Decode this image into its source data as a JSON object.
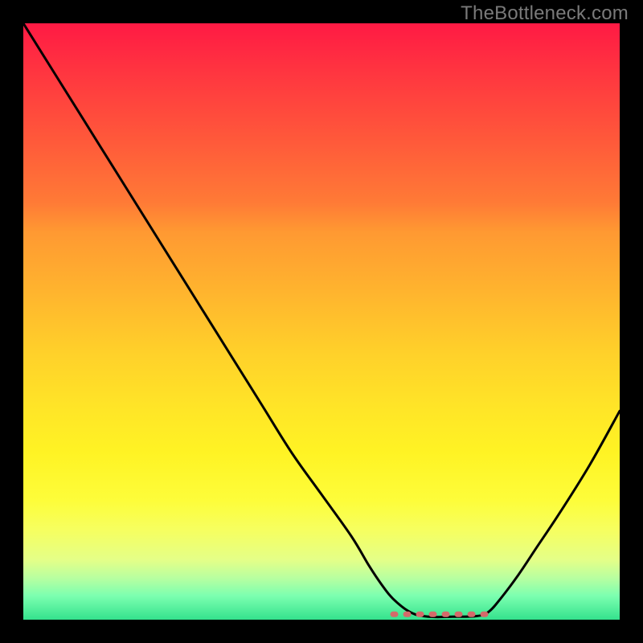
{
  "watermark": "TheBottleneck.com",
  "colors": {
    "background": "#000000",
    "gradient_top": "#ff1a44",
    "gradient_mid": "#fff324",
    "gradient_bottom": "#34e28d",
    "curve": "#000000",
    "marker": "#d46a6a",
    "watermark": "#7a7a7a"
  },
  "chart_data": {
    "type": "line",
    "title": "",
    "xlabel": "",
    "ylabel": "",
    "xlim": [
      0,
      100
    ],
    "ylim": [
      0,
      100
    ],
    "grid": false,
    "legend": false,
    "series": [
      {
        "name": "bottleneck-curve",
        "x": [
          0,
          5,
          10,
          15,
          20,
          25,
          30,
          35,
          40,
          45,
          50,
          55,
          58,
          60,
          62,
          65,
          68,
          72,
          76,
          78,
          80,
          83,
          86,
          90,
          95,
          100
        ],
        "y": [
          100,
          92,
          84,
          76,
          68,
          60,
          52,
          44,
          36,
          28,
          21,
          14,
          9,
          6,
          3.5,
          1.2,
          0.5,
          0.5,
          0.6,
          1.3,
          3.5,
          7.5,
          12,
          18,
          26,
          35
        ]
      }
    ],
    "markers": {
      "flat_region_x": [
        62,
        78
      ],
      "flat_region_y": 0.5,
      "style": "dashed",
      "color": "#d46a6a"
    },
    "annotations": []
  }
}
